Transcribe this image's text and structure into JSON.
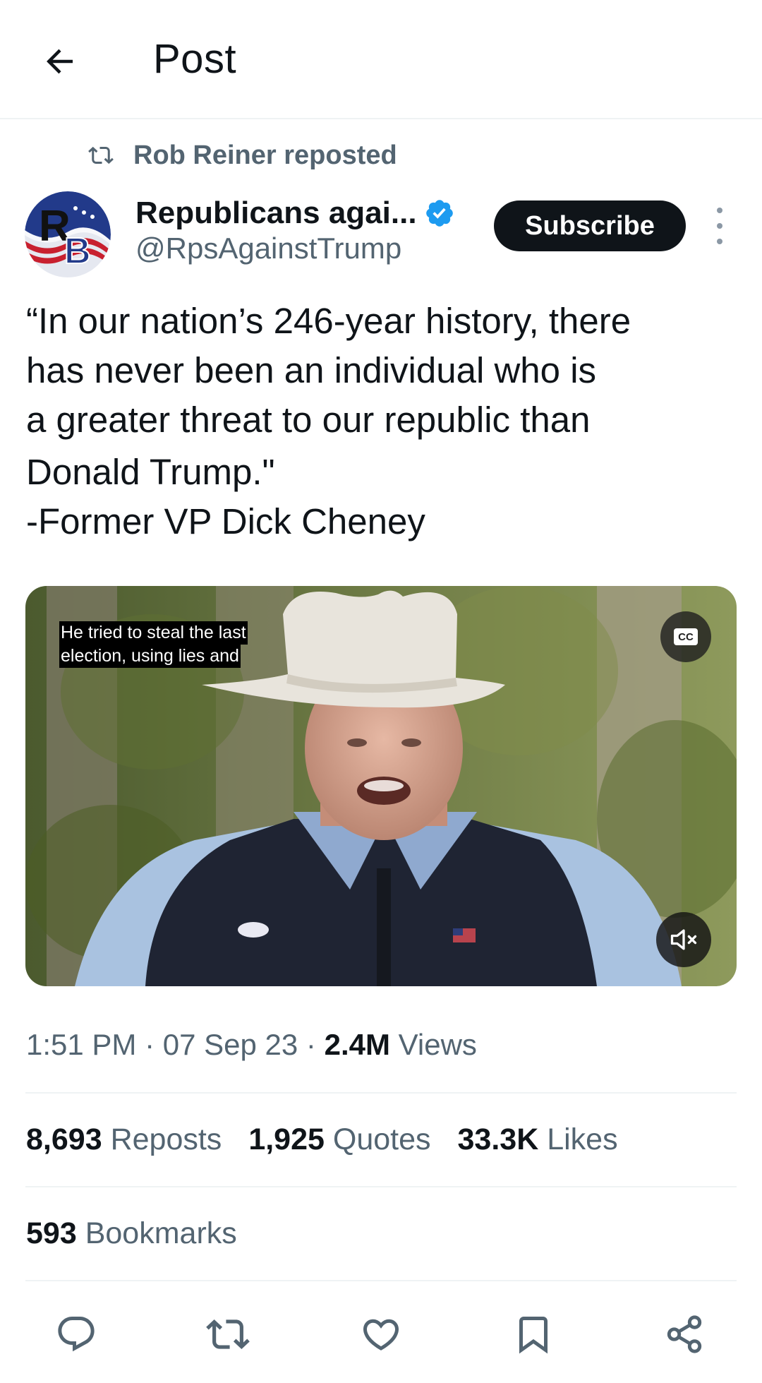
{
  "header": {
    "title": "Post"
  },
  "repost": {
    "label": "Rob Reiner reposted"
  },
  "author": {
    "display_name": "Republicans agai...",
    "handle": "@RpsAgainstTrump",
    "avatar_text": "RB",
    "verified_color": "#1d9bf0"
  },
  "subscribe_label": "Subscribe",
  "post": {
    "lines": [
      "“In our nation’s 246-year history, there",
      "has never been an individual who is",
      "a greater threat to our republic than",
      "Donald Trump.\"",
      "-Former VP Dick Cheney"
    ]
  },
  "video": {
    "caption_lines": [
      "He tried to steal the last",
      "election, using lies and"
    ],
    "cc_label": "CC"
  },
  "meta": {
    "time": "1:51 PM",
    "date": "07 Sep 23",
    "views_count": "2.4M",
    "views_label": "Views"
  },
  "stats": [
    {
      "count": "8,693",
      "label": "Reposts"
    },
    {
      "count": "1,925",
      "label": "Quotes"
    },
    {
      "count": "33.3K",
      "label": "Likes"
    }
  ],
  "bookmarks": {
    "count": "593",
    "label": "Bookmarks"
  },
  "actions": [
    "reply-icon",
    "repost-icon",
    "like-icon",
    "bookmark-icon",
    "share-icon"
  ],
  "colors": {
    "text": "#0f1419",
    "secondary": "#536471",
    "divider": "#eff3f4",
    "accent": "#1d9bf0"
  }
}
